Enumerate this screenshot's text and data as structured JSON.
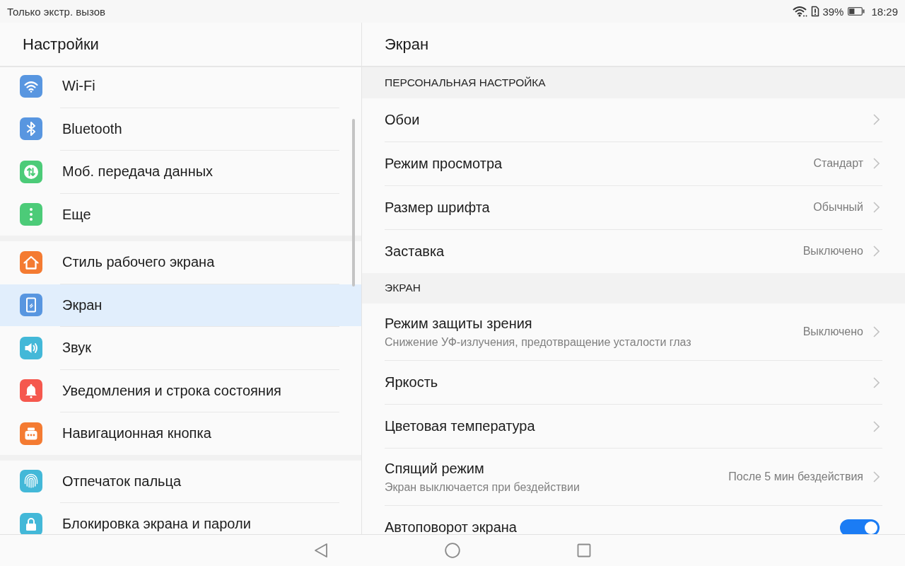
{
  "status_bar": {
    "carrier_text": "Только экстр. вызов",
    "battery_percent": "39%",
    "time": "18:29"
  },
  "sidebar": {
    "title": "Настройки",
    "groups": [
      {
        "items": [
          {
            "kind": "wifi",
            "label": "Wi-Fi",
            "color": "#5896e0",
            "selected": false
          },
          {
            "kind": "bluetooth",
            "label": "Bluetooth",
            "color": "#5896e0",
            "selected": false
          },
          {
            "kind": "data",
            "label": "Моб. передача данных",
            "color": "#4ccb78",
            "selected": false
          },
          {
            "kind": "more",
            "label": "Еще",
            "color": "#4ccb78",
            "selected": false
          }
        ]
      },
      {
        "items": [
          {
            "kind": "home",
            "label": "Стиль рабочего экрана",
            "color": "#f47b32",
            "selected": false
          },
          {
            "kind": "display",
            "label": "Экран",
            "color": "#5896e0",
            "selected": true
          },
          {
            "kind": "sound",
            "label": "Звук",
            "color": "#43b8d8",
            "selected": false
          },
          {
            "kind": "notifications",
            "label": "Уведомления и строка состояния",
            "color": "#f5584e",
            "selected": false
          },
          {
            "kind": "navigation",
            "label": "Навигационная кнопка",
            "color": "#f47b32",
            "selected": false
          }
        ]
      },
      {
        "items": [
          {
            "kind": "fingerprint",
            "label": "Отпечаток пальца",
            "color": "#43b8d8",
            "selected": false
          },
          {
            "kind": "lock",
            "label": "Блокировка экрана и пароли",
            "color": "#43b8d8",
            "selected": false
          }
        ]
      }
    ]
  },
  "detail": {
    "title": "Экран",
    "sections": [
      {
        "header": "ПЕРСОНАЛЬНАЯ НАСТРОЙКА",
        "rows": [
          {
            "kind": "link",
            "label": "Обои"
          },
          {
            "kind": "link",
            "label": "Режим просмотра",
            "value": "Стандарт"
          },
          {
            "kind": "link",
            "label": "Размер шрифта",
            "value": "Обычный"
          },
          {
            "kind": "link",
            "label": "Заставка",
            "value": "Выключено"
          }
        ]
      },
      {
        "header": "ЭКРАН",
        "rows": [
          {
            "kind": "link",
            "label": "Режим защиты зрения",
            "description": "Снижение УФ-излучения, предотвращение усталости глаз",
            "value": "Выключено"
          },
          {
            "kind": "link",
            "label": "Яркость"
          },
          {
            "kind": "link",
            "label": "Цветовая температура"
          },
          {
            "kind": "link",
            "label": "Спящий режим",
            "description": "Экран выключается при бездействии",
            "value": "После 5 мин бездействия"
          },
          {
            "kind": "toggle",
            "label": "Автоповорот экрана",
            "on": true
          }
        ]
      }
    ]
  }
}
